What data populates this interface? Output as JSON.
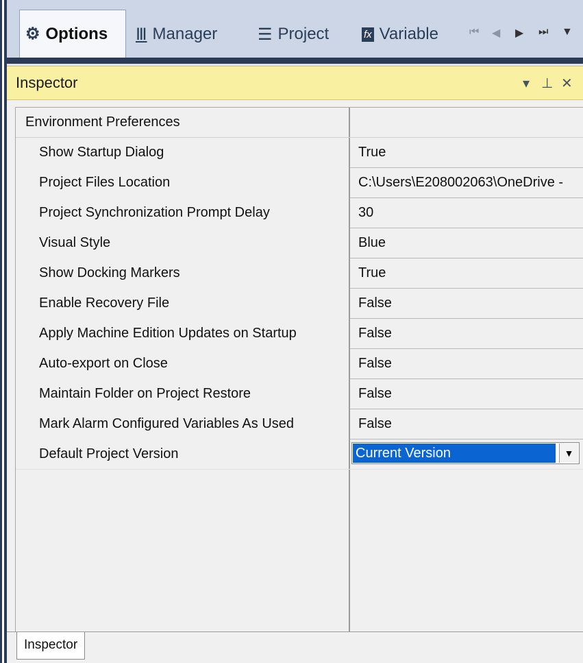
{
  "tabs": [
    {
      "label": "Options",
      "icon": "gear-icon",
      "glyph": "⚙"
    },
    {
      "label": "Manager",
      "icon": "library-icon",
      "glyph": "Ⅲ"
    },
    {
      "label": "Project",
      "icon": "list-icon",
      "glyph": "☰"
    },
    {
      "label": "Variable",
      "icon": "fx-icon",
      "glyph": "fx"
    }
  ],
  "nav": {
    "first": "⏮",
    "prev": "◀",
    "next": "▶",
    "last": "⏭",
    "menu": "▼"
  },
  "inspector": {
    "title": "Inspector",
    "dropdown_glyph": "▾",
    "pin_glyph": "⊥",
    "close_glyph": "✕"
  },
  "properties": {
    "group": "Environment Preferences",
    "rows": [
      {
        "name": "Show Startup Dialog",
        "value": "True"
      },
      {
        "name": "Project Files Location",
        "value": "C:\\Users\\E208002063\\OneDrive -"
      },
      {
        "name": "Project Synchronization Prompt Delay",
        "value": "30"
      },
      {
        "name": "Visual Style",
        "value": "Blue"
      },
      {
        "name": "Show Docking Markers",
        "value": "True"
      },
      {
        "name": "Enable Recovery File",
        "value": "False"
      },
      {
        "name": "Apply Machine Edition Updates on Startup",
        "value": "False"
      },
      {
        "name": "Auto-export on Close",
        "value": "False"
      },
      {
        "name": "Maintain Folder on Project Restore",
        "value": "False"
      },
      {
        "name": "Mark Alarm Configured Variables As Used",
        "value": "False"
      }
    ],
    "default_version": {
      "name": "Default Project Version",
      "value": "Current Version",
      "arrow": "▼"
    }
  },
  "bottom_tab": "Inspector",
  "colors": {
    "header_bg": "#faf0a2",
    "selection": "#0a64d2",
    "frame": "#2b3a55"
  }
}
